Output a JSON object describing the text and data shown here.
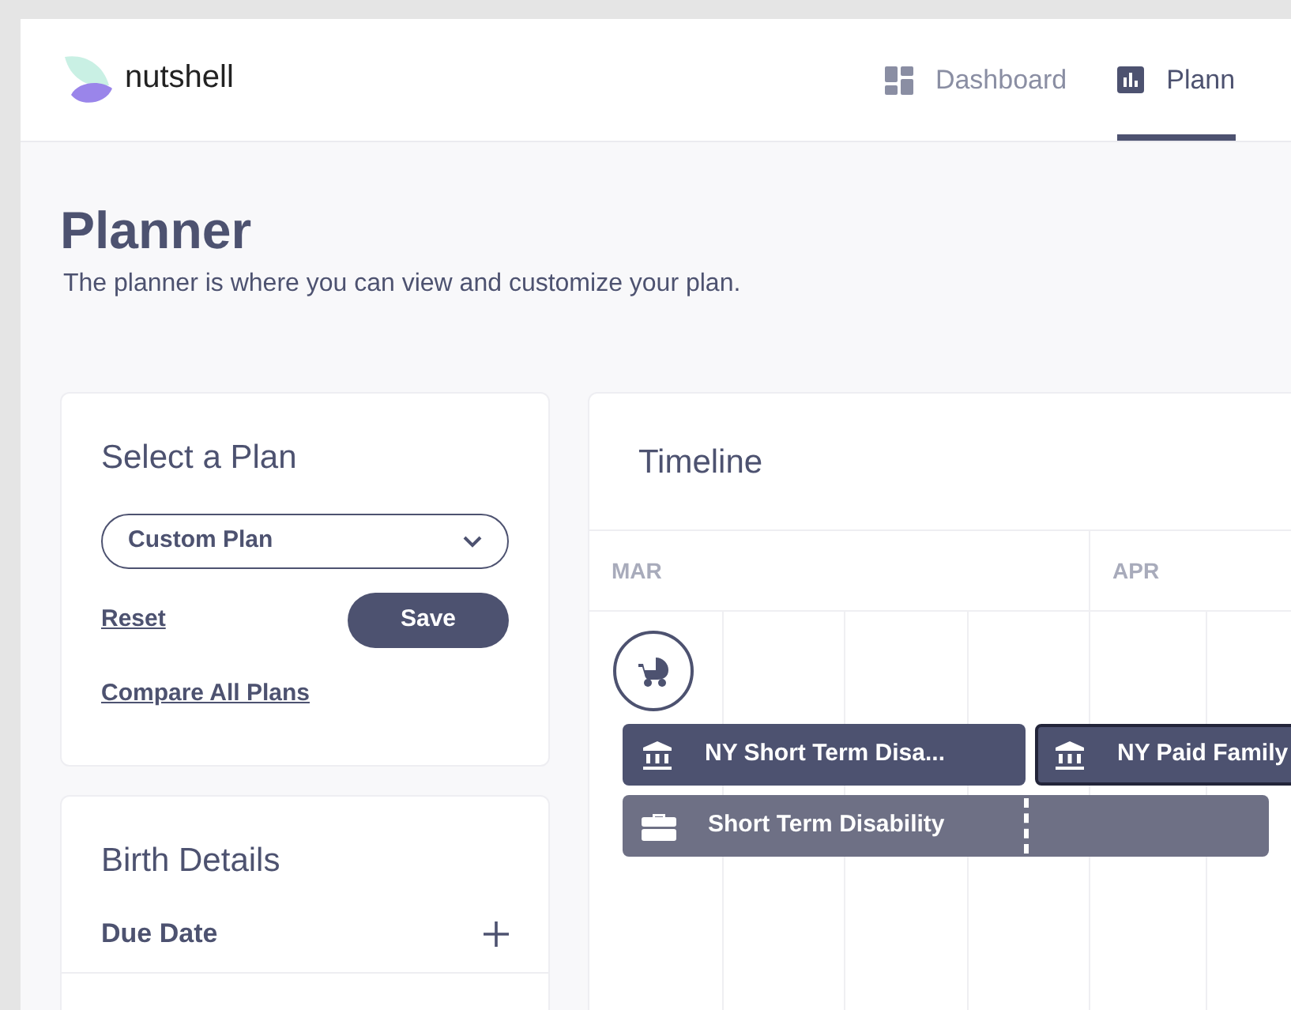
{
  "header": {
    "logo": "nutshell",
    "nav": [
      {
        "label": "Dashboard",
        "kind": "dashboard",
        "selected": false
      },
      {
        "label": "Plann",
        "kind": "chart",
        "selected": true
      }
    ]
  },
  "page": {
    "title": "Planner",
    "subtitle": "The planner is where you can view and customize your plan."
  },
  "plan_card": {
    "title": "Select a Plan",
    "select": {
      "value": "Custom Plan"
    },
    "reset": "Reset",
    "save": "Save",
    "compare": "Compare All Plans"
  },
  "birth_card": {
    "title": "Birth Details",
    "rows": [
      {
        "label": "Due Date"
      }
    ]
  },
  "timeline": {
    "title": "Timeline",
    "months": [
      {
        "label": "MAR"
      },
      {
        "label": "APR"
      }
    ],
    "bar_rows": [
      {
        "bars": [
          {
            "label": "NY Short Term Disa...",
            "kind": "state",
            "selected": false
          },
          {
            "label": "NY Paid Family",
            "kind": "state",
            "selected": true
          }
        ]
      },
      {
        "bars": [
          {
            "label": "Short Term Disability",
            "kind": "employer",
            "selected": false
          }
        ]
      }
    ]
  }
}
